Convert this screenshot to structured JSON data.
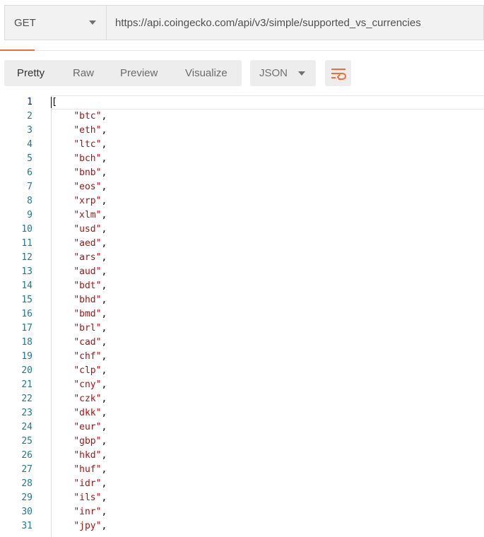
{
  "request": {
    "method": "GET",
    "url": "https://api.coingecko.com/api/v3/simple/supported_vs_currencies"
  },
  "view_tabs": [
    {
      "label": "Pretty",
      "active": true
    },
    {
      "label": "Raw",
      "active": false
    },
    {
      "label": "Preview",
      "active": false
    },
    {
      "label": "Visualize",
      "active": false
    }
  ],
  "format": {
    "selected": "JSON"
  },
  "icons": {
    "method_dropdown": "chevron-down-icon",
    "format_dropdown": "chevron-down-icon",
    "wrap": "wrap-lines-icon"
  },
  "colors": {
    "accent": "#f26b3a",
    "string": "#a31515",
    "line_number": "#237893"
  },
  "code": {
    "open_bracket": "[",
    "items": [
      "btc",
      "eth",
      "ltc",
      "bch",
      "bnb",
      "eos",
      "xrp",
      "xlm",
      "usd",
      "aed",
      "ars",
      "aud",
      "bdt",
      "bhd",
      "bmd",
      "brl",
      "cad",
      "chf",
      "clp",
      "cny",
      "czk",
      "dkk",
      "eur",
      "gbp",
      "hkd",
      "huf",
      "idr",
      "ils",
      "inr",
      "jpy"
    ]
  }
}
